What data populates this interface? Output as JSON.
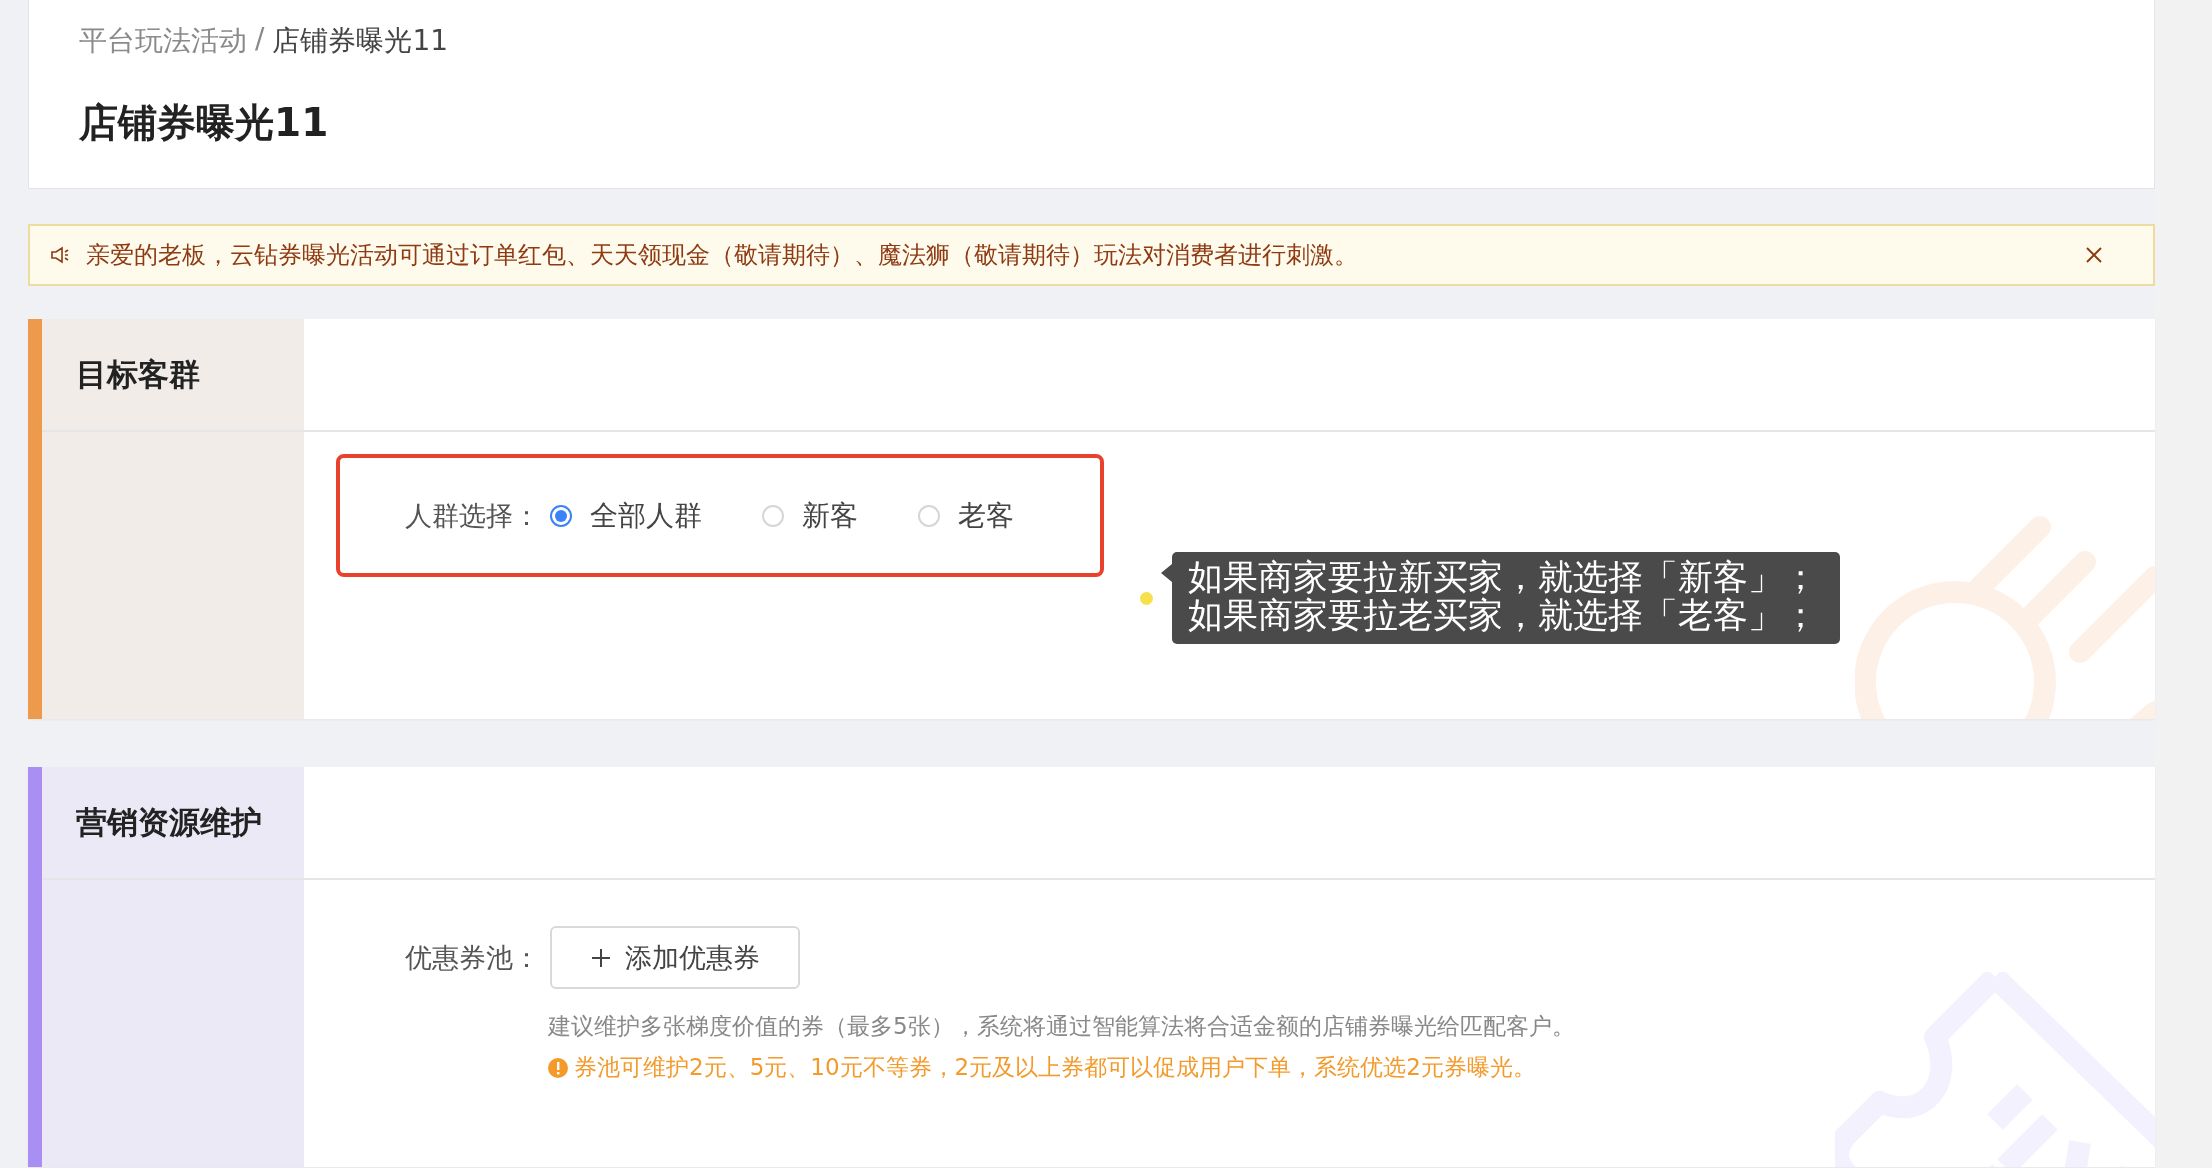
{
  "breadcrumb": {
    "items": [
      {
        "label": "平台玩法活动",
        "current": false
      },
      {
        "label": "店铺券曝光11",
        "current": true
      }
    ],
    "separator": "/"
  },
  "page_title": "店铺券曝光11",
  "notice": {
    "text": "亲爱的老板，云钻券曝光活动可通过订单红包、天天领现金（敬请期待）、魔法狮（敬请期待）玩法对消费者进行刺激。"
  },
  "sections": [
    {
      "kind": "audience",
      "title": "目标客群",
      "color": "#ee9a4d",
      "field": {
        "label": "人群选择：",
        "highlighted": true,
        "options": [
          {
            "label": "全部人群",
            "selected": true
          },
          {
            "label": "新客",
            "selected": false
          },
          {
            "label": "老客",
            "selected": false
          }
        ]
      },
      "tooltip": {
        "lines": [
          "如果商家要拉新买家，就选择「新客」；",
          "如果商家要拉老买家，就选择「老客」；"
        ]
      }
    },
    {
      "kind": "coupon",
      "title": "营销资源维护",
      "color": "#a98ef3",
      "field": {
        "label": "优惠券池：",
        "button": "添加优惠券",
        "hint": "建议维护多张梯度价值的券（最多5张），系统将通过智能算法将合适金额的店铺券曝光给匹配客户。",
        "warning": "券池可维护2元、5元、10元不等券，2元及以上券都可以促成用户下单，系统优选2元券曝光。"
      }
    }
  ]
}
